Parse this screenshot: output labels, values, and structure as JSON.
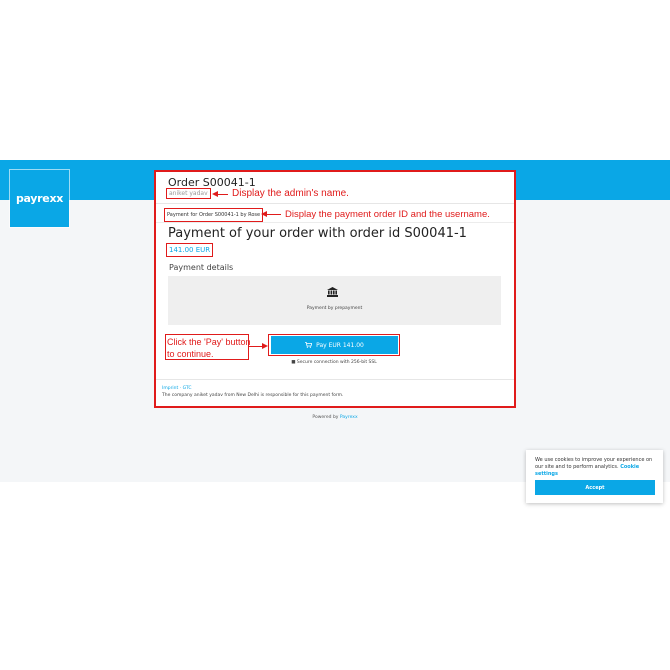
{
  "brand": {
    "logo_text": "payrexx",
    "accent": "#0aa7e6"
  },
  "order": {
    "title": "Order S00041-1",
    "admin_name": "aniket yadav",
    "payment_for": "Payment for Order S00041-1 by Rose",
    "heading": "Payment of your order with order id S00041-1",
    "amount": "141.00 EUR"
  },
  "payment": {
    "details_title": "Payment details",
    "method_icon": "bank-icon",
    "method_label": "Payment by prepayment",
    "pay_button_label": "Pay EUR 141.00",
    "secure_text": "Secure connection with 256-bit SSL"
  },
  "footer": {
    "imprint": "Imprint · GTC",
    "responsibility": "The company aniket yadav from New Delhi is responsible for this payment form.",
    "powered_by_prefix": "Powered by ",
    "powered_by_link": "Payrexx"
  },
  "annotations": {
    "admin_note": "Display the admin's name.",
    "id_note": "Display the payment order ID and the username.",
    "pay_note_line1": "Click the 'Pay' button",
    "pay_note_line2": "to continue.",
    "color": "#e01b1b"
  },
  "cookie_banner": {
    "text": "We use cookies to improve your experience on our site and to perform analytics. ",
    "settings_link": "Cookie settings",
    "accept_label": "Accept"
  }
}
